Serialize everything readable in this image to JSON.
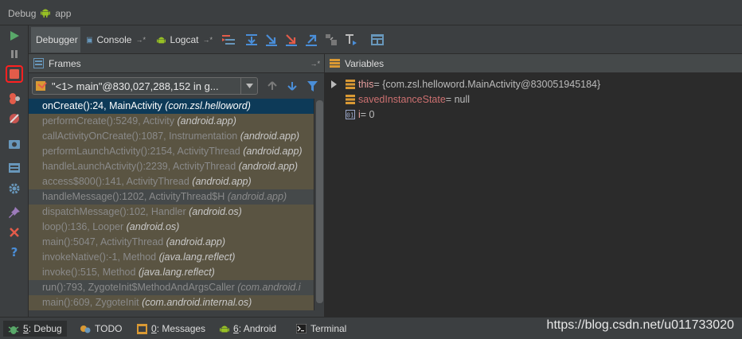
{
  "window": {
    "title": "Debug",
    "app": "app"
  },
  "tabs": [
    {
      "label": "Debugger",
      "pin": ""
    },
    {
      "label": "Console",
      "pin": "→*"
    },
    {
      "label": "Logcat",
      "pin": "→*"
    }
  ],
  "panels": {
    "frames_title": "Frames",
    "frames_pin": "→*",
    "variables_title": "Variables"
  },
  "thread": {
    "selected": "\"<1> main\"@830,027,288,152 in g..."
  },
  "frames": [
    {
      "method": "onCreate():24, MainActivity ",
      "pkg": "(com.zsl.helloword)",
      "style": "selected"
    },
    {
      "method": "performCreate():5249, Activity ",
      "pkg": "(android.app)",
      "style": "lib"
    },
    {
      "method": "callActivityOnCreate():1087, Instrumentation ",
      "pkg": "(android.app)",
      "style": "lib"
    },
    {
      "method": "performLaunchActivity():2154, ActivityThread ",
      "pkg": "(android.app)",
      "style": "lib"
    },
    {
      "method": "handleLaunchActivity():2239, ActivityThread ",
      "pkg": "(android.app)",
      "style": "lib"
    },
    {
      "method": "access$800():141, ActivityThread ",
      "pkg": "(android.app)",
      "style": "lib"
    },
    {
      "method": "handleMessage():1202, ActivityThread$H ",
      "pkg": "(android.app)",
      "style": "plain"
    },
    {
      "method": "dispatchMessage():102, Handler ",
      "pkg": "(android.os)",
      "style": "lib"
    },
    {
      "method": "loop():136, Looper ",
      "pkg": "(android.os)",
      "style": "lib"
    },
    {
      "method": "main():5047, ActivityThread ",
      "pkg": "(android.app)",
      "style": "lib"
    },
    {
      "method": "invokeNative():-1, Method ",
      "pkg": "(java.lang.reflect)",
      "style": "lib"
    },
    {
      "method": "invoke():515, Method ",
      "pkg": "(java.lang.reflect)",
      "style": "lib"
    },
    {
      "method": "run():793, ZygoteInit$MethodAndArgsCaller ",
      "pkg": "(com.android.i",
      "style": "plain"
    },
    {
      "method": "main():609, ZygoteInit ",
      "pkg": "(com.android.internal.os)",
      "style": "lib"
    }
  ],
  "variables": [
    {
      "name": "this",
      "value": " = {com.zsl.helloword.MainActivity@830051945184}",
      "expandable": true,
      "icon": "field-icon"
    },
    {
      "name": "savedInstanceState",
      "value": " = null",
      "expandable": false,
      "icon": "field-icon"
    },
    {
      "name": "i",
      "value": " = 0",
      "expandable": false,
      "icon": "primitive-icon"
    }
  ],
  "statusbar": [
    {
      "num": "5",
      "label": ": Debug"
    },
    {
      "num": "",
      "label": "TODO"
    },
    {
      "num": "0",
      "label": ": Messages"
    },
    {
      "num": "6",
      "label": ": Android"
    },
    {
      "num": "",
      "label": "Terminal"
    }
  ],
  "watermark": "https://blog.csdn.net/u011733020",
  "colors": {
    "selected_row": "#0d3a58",
    "library_row": "#5a5442",
    "stop_highlight": "#ff2020"
  }
}
